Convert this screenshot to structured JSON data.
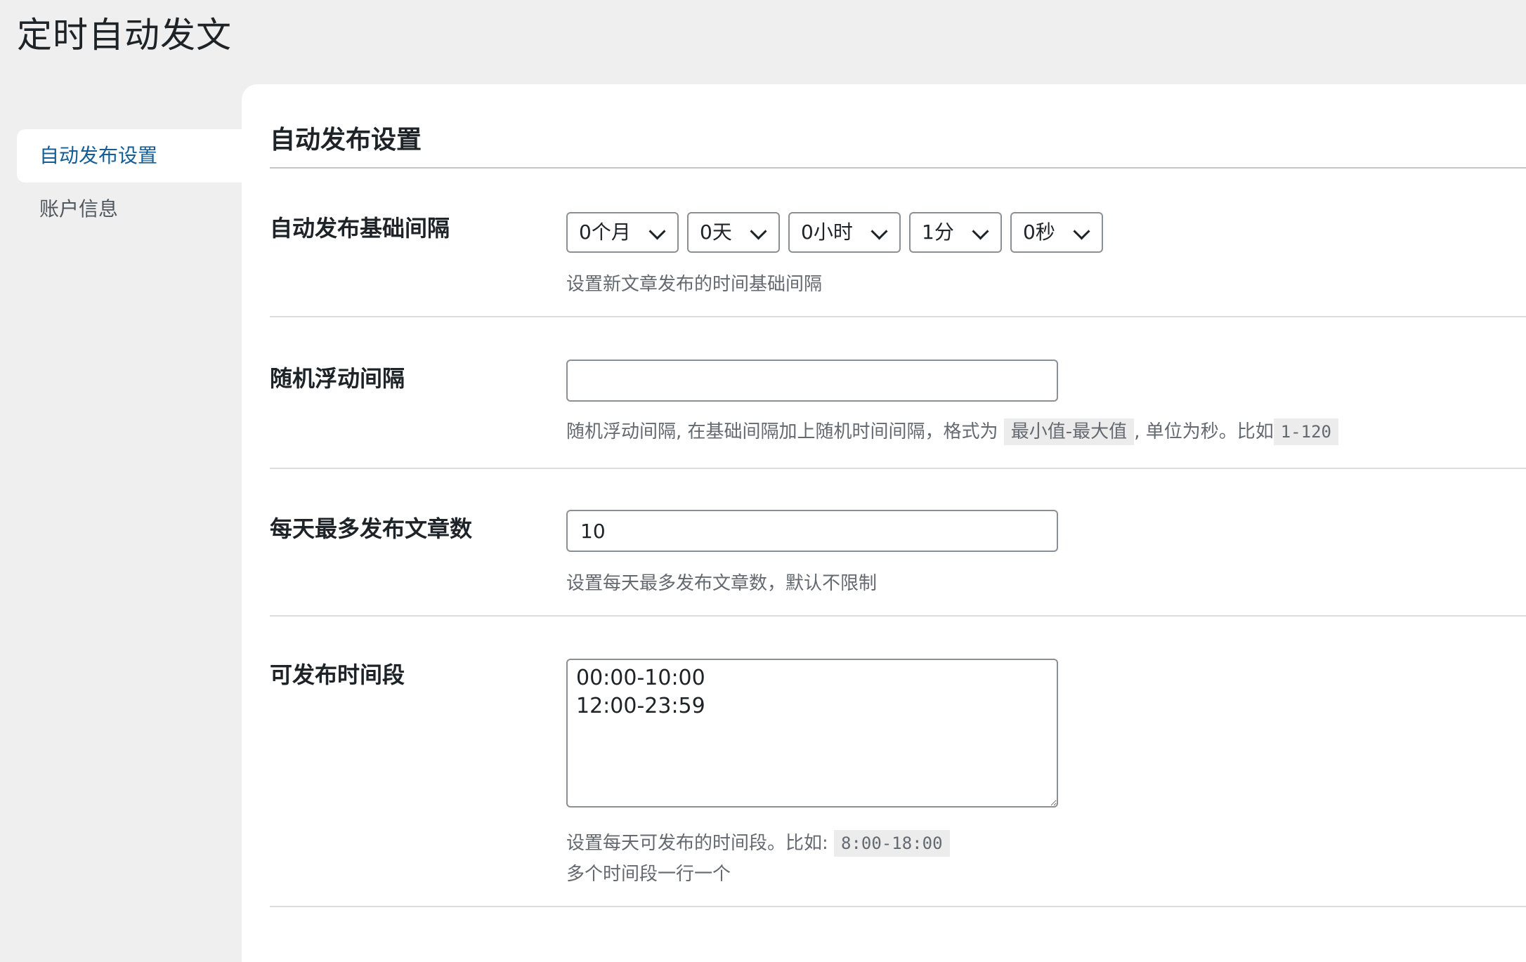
{
  "page": {
    "title": "定时自动发文"
  },
  "sidebar": {
    "items": [
      {
        "label": "自动发布设置",
        "active": true
      },
      {
        "label": "账户信息",
        "active": false
      }
    ]
  },
  "section": {
    "title": "自动发布设置"
  },
  "interval": {
    "label": "自动发布基础间隔",
    "selects": [
      {
        "value": "0个月"
      },
      {
        "value": "0天"
      },
      {
        "value": "0小时"
      },
      {
        "value": "1分"
      },
      {
        "value": "0秒"
      }
    ],
    "description": "设置新文章发布的时间基础间隔"
  },
  "random": {
    "label": "随机浮动间隔",
    "value": "",
    "desc_prefix": "随机浮动间隔, 在基础间隔加上随机时间间隔，格式为",
    "desc_format_code": "最小值-最大值",
    "desc_middle": ", 单位为秒。比如",
    "desc_example_code": "1-120"
  },
  "max_per_day": {
    "label": "每天最多发布文章数",
    "value": "10",
    "description": "设置每天最多发布文章数，默认不限制"
  },
  "time_windows": {
    "label": "可发布时间段",
    "value": "00:00-10:00\n12:00-23:59",
    "desc_prefix": "设置每天可发布的时间段。比如:",
    "desc_example_code": "8:00-18:00",
    "desc_line2": "多个时间段一行一个"
  }
}
